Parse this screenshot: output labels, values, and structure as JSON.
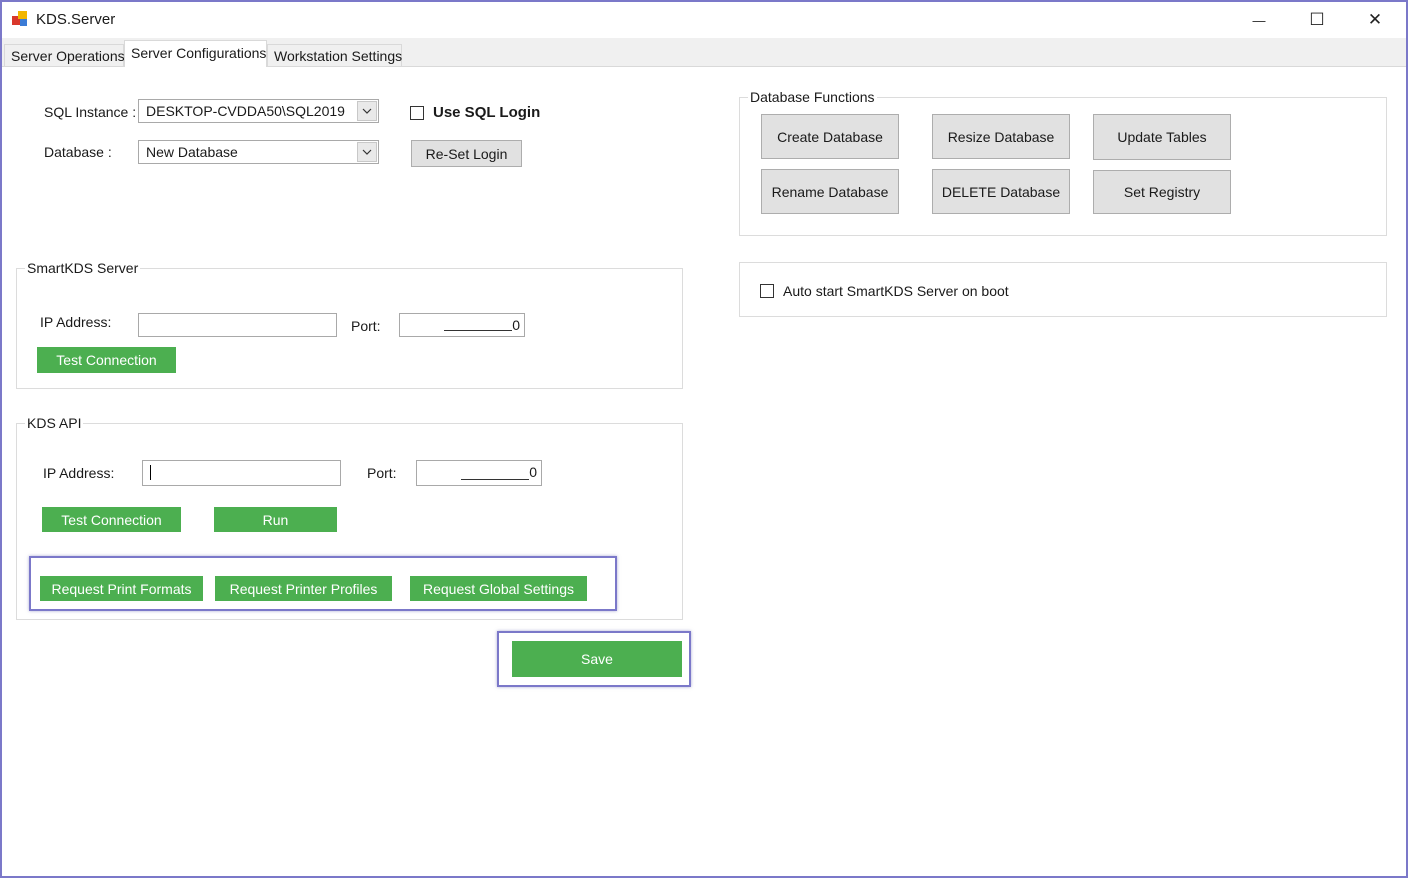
{
  "window": {
    "title": "KDS.Server",
    "controls": {
      "minimize": "—",
      "maximize": "☐",
      "close": "✕"
    }
  },
  "tabs": [
    {
      "label": "Server Operations",
      "active": false
    },
    {
      "label": "Server Configurations",
      "active": true
    },
    {
      "label": "Workstation Settings",
      "active": false
    }
  ],
  "sql": {
    "instance_label": "SQL Instance :",
    "instance_value": "DESKTOP-CVDDA50\\SQL2019",
    "database_label": "Database :",
    "database_value": "New Database",
    "use_sql_login_label": "Use SQL Login",
    "use_sql_login_checked": false,
    "reset_login_label": "Re-Set Login"
  },
  "smartkds_server": {
    "title": "SmartKDS Server",
    "ip_label": "IP Address:",
    "ip_value": "",
    "port_label": "Port:",
    "port_value": "0",
    "test_label": "Test Connection"
  },
  "kds_api": {
    "title": "KDS API",
    "ip_label": "IP Address:",
    "ip_value": "",
    "port_label": "Port:",
    "port_value": "0",
    "test_label": "Test Connection",
    "run_label": "Run",
    "request_print_formats": "Request Print Formats",
    "request_printer_profiles": "Request Printer Profiles",
    "request_global_settings": "Request Global Settings"
  },
  "save_label": "Save",
  "database_functions": {
    "title": "Database Functions",
    "create": "Create Database",
    "resize": "Resize Database",
    "update": "Update Tables",
    "rename": "Rename Database",
    "delete": "DELETE Database",
    "registry": "Set Registry"
  },
  "autostart": {
    "label": "Auto start SmartKDS Server on boot",
    "checked": false
  },
  "colors": {
    "accent_green": "#4caf50",
    "highlight": "#7b78c9"
  },
  "icons": [
    "app-icon",
    "dropdown-arrow-icon",
    "minimize-icon",
    "maximize-icon",
    "close-icon"
  ]
}
